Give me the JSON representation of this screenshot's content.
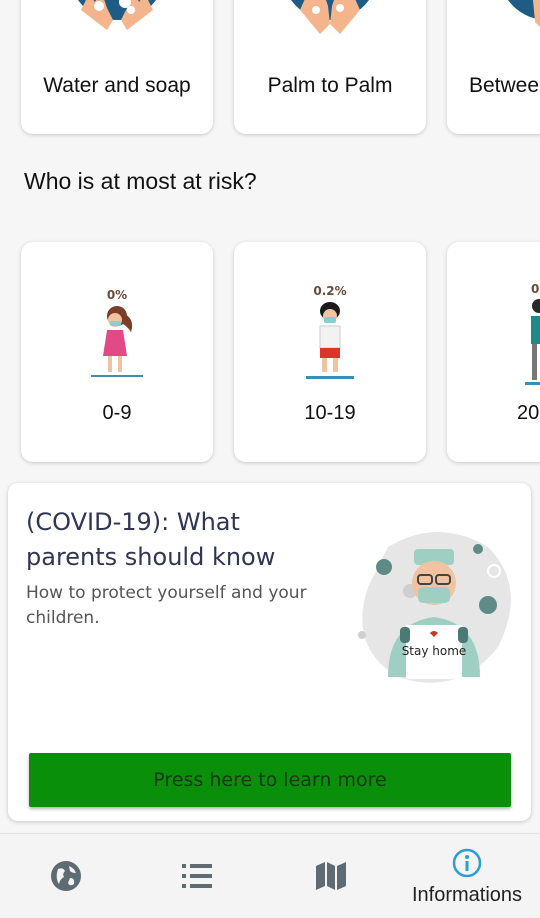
{
  "washing": {
    "cards": [
      {
        "label": "Water and soap",
        "icon": "hands-soap-icon"
      },
      {
        "label": "Palm to Palm",
        "icon": "palm-to-palm-icon"
      },
      {
        "label": "Betwee",
        "icon": "between-fingers-icon"
      }
    ]
  },
  "risk": {
    "title": "Who is at most at risk?",
    "cards": [
      {
        "percent": "0%",
        "label": "0-9"
      },
      {
        "percent": "0.2%",
        "label": "10-19"
      },
      {
        "percent": "0.",
        "label": "20"
      }
    ]
  },
  "info": {
    "title": "(COVID-19): What parents should know",
    "subtitle": "How to protect yourself and your children.",
    "sign_text": "Stay home",
    "button_label": "Press here to learn more"
  },
  "nav": {
    "items": [
      {
        "icon": "globe-icon",
        "label": ""
      },
      {
        "icon": "list-icon",
        "label": ""
      },
      {
        "icon": "map-icon",
        "label": ""
      },
      {
        "icon": "info-icon",
        "label": "Informations",
        "active": true
      }
    ]
  },
  "colors": {
    "accent_blue": "#1e5c86",
    "nav_active": "#2a9fd6",
    "button_green": "#0a8f0a",
    "nav_icon_gray": "#5f6b73"
  }
}
